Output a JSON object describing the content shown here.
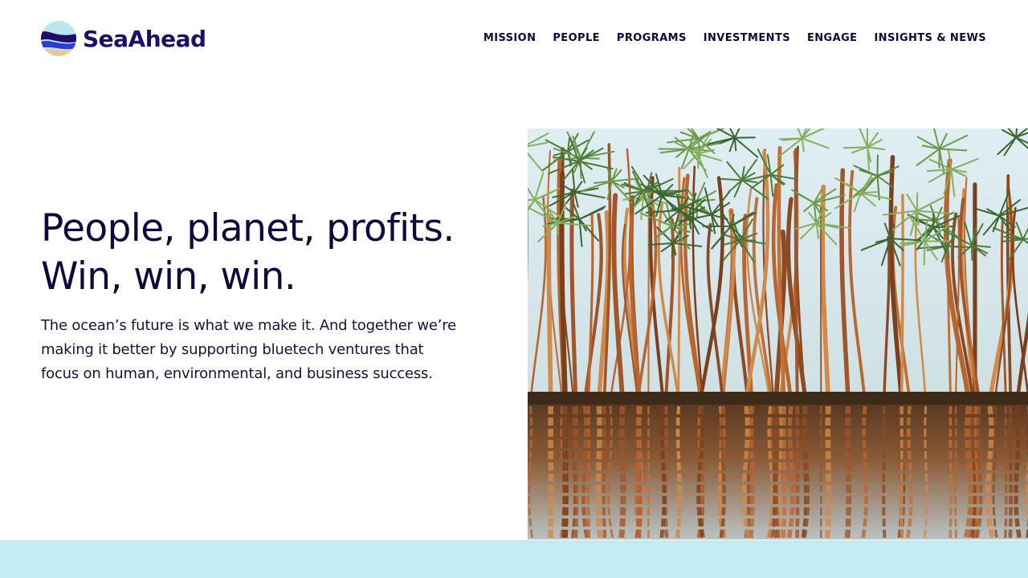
{
  "brand": {
    "name": "SeaAhead",
    "logo_icon": "waves-logo-icon",
    "colors": {
      "navy": "#1e0e6b",
      "blue": "#2b3bd6",
      "sky": "#b9e6ef",
      "sand": "#e8c99a",
      "band": "#c4edf3",
      "text": "#0d0a3e"
    }
  },
  "nav": {
    "items": [
      {
        "label": "MISSION"
      },
      {
        "label": "PEOPLE"
      },
      {
        "label": "PROGRAMS"
      },
      {
        "label": "INVESTMENTS"
      },
      {
        "label": "ENGAGE"
      },
      {
        "label": "INSIGHTS & NEWS"
      }
    ]
  },
  "hero": {
    "title_line1": "People, planet, profits.",
    "title_line2": "Win, win, win.",
    "body": "The ocean’s future is what we make it. And together we’re making it better by supporting bluetech ventures that focus on human, environmental, and business success.",
    "image_subject": "mangrove-trees-reflected-in-water"
  }
}
